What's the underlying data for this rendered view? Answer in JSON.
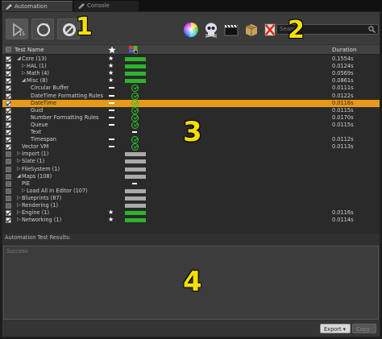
{
  "tabs": [
    {
      "label": "Automation",
      "active": true
    },
    {
      "label": "Console",
      "active": false
    }
  ],
  "toolbar": {
    "run_badge": "15",
    "search_placeholder": "Search"
  },
  "columns": {
    "test_name": "Test Name",
    "duration": "Duration"
  },
  "tests": [
    {
      "name": "Core (13)",
      "level": 1,
      "arrow": "open",
      "checked": true,
      "flag": "star",
      "status": "green",
      "duration": "0.1554s"
    },
    {
      "name": "HAL (1)",
      "level": 2,
      "arrow": "closed",
      "checked": true,
      "flag": "star",
      "status": "green",
      "duration": "0.0124s"
    },
    {
      "name": "Math (4)",
      "level": 2,
      "arrow": "closed",
      "checked": true,
      "flag": "star",
      "status": "green",
      "duration": "0.0569s"
    },
    {
      "name": "Misc (8)",
      "level": 2,
      "arrow": "open",
      "checked": true,
      "flag": "star",
      "status": "green",
      "duration": "0.0861s"
    },
    {
      "name": "Circular Buffer",
      "level": 3,
      "arrow": "",
      "checked": true,
      "flag": "dash",
      "status": "pass",
      "duration": "0.0111s"
    },
    {
      "name": "DateTime Formatting Rules",
      "level": 3,
      "arrow": "",
      "checked": true,
      "flag": "dash",
      "status": "pass",
      "duration": "0.0122s"
    },
    {
      "name": "DateTime",
      "level": 3,
      "arrow": "",
      "checked": true,
      "flag": "dash",
      "status": "pass",
      "duration": "0.0116s",
      "selected": true
    },
    {
      "name": "Guid",
      "level": 3,
      "arrow": "",
      "checked": true,
      "flag": "dash",
      "status": "pass",
      "duration": "0.0115s"
    },
    {
      "name": "Number Formatting Rules",
      "level": 3,
      "arrow": "",
      "checked": true,
      "flag": "dash",
      "status": "pass",
      "duration": "0.0170s"
    },
    {
      "name": "Queue",
      "level": 3,
      "arrow": "",
      "checked": true,
      "flag": "dash",
      "status": "pass",
      "duration": "0.0115s"
    },
    {
      "name": "Text",
      "level": 3,
      "arrow": "",
      "checked": true,
      "flag": "",
      "status": "dash",
      "duration": ""
    },
    {
      "name": "Timespan",
      "level": 3,
      "arrow": "",
      "checked": true,
      "flag": "dash",
      "status": "pass",
      "duration": "0.0112s"
    },
    {
      "name": "Vector VM",
      "level": 2,
      "arrow": "",
      "checked": true,
      "flag": "dash",
      "status": "pass",
      "duration": "0.0113s"
    },
    {
      "name": "Import (1)",
      "level": 1,
      "arrow": "closed",
      "checked": false,
      "flag": "",
      "status": "gray",
      "duration": ""
    },
    {
      "name": "Slate (1)",
      "level": 1,
      "arrow": "closed",
      "checked": false,
      "flag": "",
      "status": "gray",
      "duration": ""
    },
    {
      "name": "FileSystem (1)",
      "level": 1,
      "arrow": "closed",
      "checked": false,
      "flag": "",
      "status": "gray",
      "duration": ""
    },
    {
      "name": "Maps (108)",
      "level": 1,
      "arrow": "open",
      "checked": false,
      "flag": "",
      "status": "gray",
      "duration": ""
    },
    {
      "name": "PIE",
      "level": 2,
      "arrow": "",
      "checked": false,
      "flag": "",
      "status": "dash",
      "duration": ""
    },
    {
      "name": "Load All In Editor (107)",
      "level": 2,
      "arrow": "closed",
      "checked": false,
      "flag": "",
      "status": "gray",
      "duration": ""
    },
    {
      "name": "Blueprints (87)",
      "level": 1,
      "arrow": "closed",
      "checked": false,
      "flag": "",
      "status": "gray",
      "duration": ""
    },
    {
      "name": "Rendering (1)",
      "level": 1,
      "arrow": "closed",
      "checked": false,
      "flag": "",
      "status": "gray",
      "duration": ""
    },
    {
      "name": "Engine (1)",
      "level": 1,
      "arrow": "closed",
      "checked": true,
      "flag": "star",
      "status": "green",
      "duration": "0.0116s"
    },
    {
      "name": "Networking (1)",
      "level": 1,
      "arrow": "closed",
      "checked": true,
      "flag": "star",
      "status": "green",
      "duration": "0.0114s"
    }
  ],
  "results": {
    "label": "Automation Test Results:",
    "text": "Success"
  },
  "footer": {
    "export_label": "Export ▾",
    "copy_label": "Copy"
  },
  "callouts": {
    "one": "1",
    "two": "2",
    "three": "3",
    "four": "4"
  },
  "colors": {
    "selection": "#e79a17",
    "pass_green": "#2bb52b",
    "callout_yellow": "#f3e000"
  }
}
